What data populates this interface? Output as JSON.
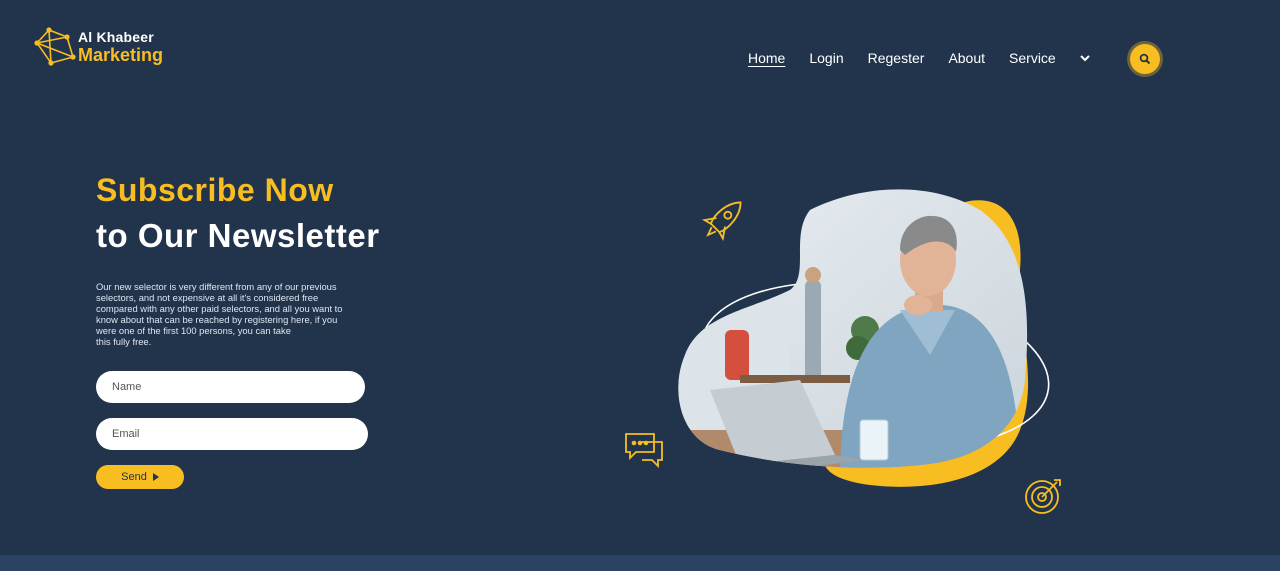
{
  "brand": {
    "line1": "Al Khabeer",
    "line2": "Marketing"
  },
  "nav": {
    "items": [
      {
        "label": "Home",
        "active": true
      },
      {
        "label": "Login",
        "active": false
      },
      {
        "label": "Regester",
        "active": false
      },
      {
        "label": "About",
        "active": false
      },
      {
        "label": "Service",
        "active": false
      }
    ]
  },
  "hero": {
    "headline_line1": "Subscribe Now",
    "headline_line2": "to Our Newsletter",
    "description_lines": [
      "Our new selector is very different from any of our previous",
      "selectors, and not expensive at all it's considered free",
      "compared with any other paid selectors, and all you want to",
      "know about that can be reached by registering here, if you",
      "were one of the first 100 persons, you can take",
      "this fully free."
    ]
  },
  "form": {
    "name_placeholder": "Name",
    "email_placeholder": "Email",
    "send_label": "Send"
  },
  "colors": {
    "background": "#22344c",
    "accent": "#f8bd20",
    "text": "#ffffff"
  },
  "icons": [
    "logo-network-icon",
    "chevron-down-icon",
    "search-icon",
    "rocket-icon",
    "chat-bubbles-icon",
    "target-icon"
  ]
}
